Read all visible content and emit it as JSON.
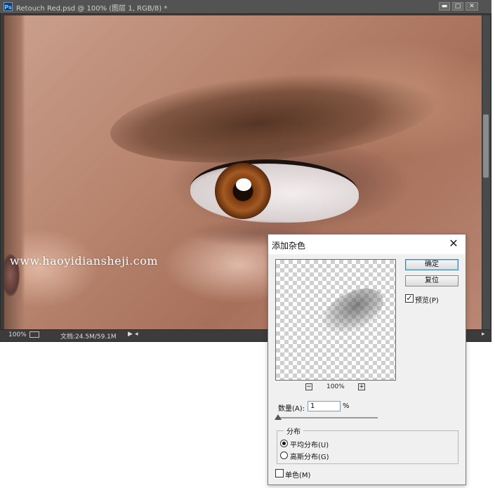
{
  "window": {
    "title": "Retouch Red.psd @ 100% (图层 1, RGB/8) *",
    "app_icon": "Ps",
    "controls": {
      "minimize": "▬",
      "maximize": "□",
      "close": "✕"
    }
  },
  "canvas": {
    "watermark": "www.haoyidiansheji.com"
  },
  "statusbar": {
    "zoom": "100%",
    "doc_info": "文档:24.5M/59.1M",
    "arrow": "▶",
    "left_arrow": "◂",
    "right_arrow": "▸"
  },
  "dialog": {
    "title": "添加杂色",
    "close": "✕",
    "ok_label": "确定",
    "reset_label": "复位",
    "preview_label": "预览(P)",
    "preview_checked": "✓",
    "zoom_out": "−",
    "zoom_in": "+",
    "preview_zoom": "100%",
    "amount_label": "数量(A):",
    "amount_value": "1",
    "amount_unit": "%",
    "amount_slider_fraction": 0.0025,
    "distribution_title": "分布",
    "uniform_label": "平均分布(U)",
    "gaussian_label": "高斯分布(G)",
    "selected_distribution": "uniform",
    "monochromatic_label": "单色(M)",
    "monochromatic_checked": false
  },
  "icons": {
    "app": "photoshop-icon",
    "close": "close-icon",
    "check": "check-icon",
    "zoom_out": "minus-icon",
    "zoom_in": "plus-icon"
  }
}
